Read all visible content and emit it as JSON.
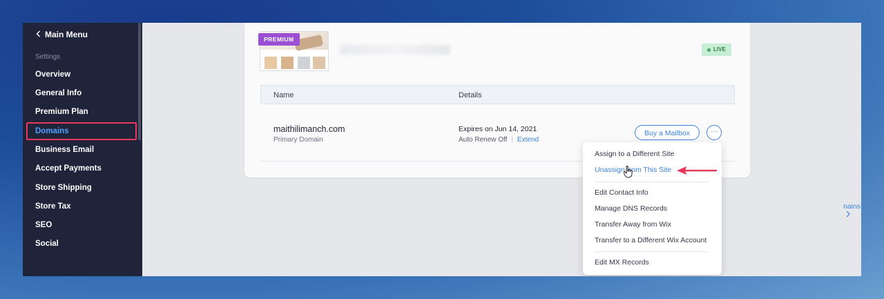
{
  "sidebar": {
    "back_label": "Main Menu",
    "section_label": "Settings",
    "items": [
      {
        "label": "Overview"
      },
      {
        "label": "General Info"
      },
      {
        "label": "Premium Plan"
      },
      {
        "label": "Domains"
      },
      {
        "label": "Business Email"
      },
      {
        "label": "Accept Payments"
      },
      {
        "label": "Store Shipping"
      },
      {
        "label": "Store Tax"
      },
      {
        "label": "SEO"
      },
      {
        "label": "Social"
      }
    ],
    "active": "Domains"
  },
  "site": {
    "premium_badge": "PREMIUM",
    "status_badge": "LIVE"
  },
  "table": {
    "col_name": "Name",
    "col_details": "Details"
  },
  "domain": {
    "name": "maithilimanch.com",
    "type": "Primary Domain",
    "expires": "Expires on Jun 14, 2021",
    "auto_renew": "Auto Renew Off",
    "separator": "|",
    "extend": "Extend",
    "mailbox_button": "Buy a Mailbox",
    "more_button": "···"
  },
  "peek_link": "nains",
  "menu": {
    "items": [
      "Assign to a Different Site",
      "Unassign from This Site",
      "Edit Contact Info",
      "Manage DNS Records",
      "Transfer Away from Wix",
      "Transfer to a Different Wix Account",
      "Edit MX Records"
    ]
  },
  "colors": {
    "accent": "#3b82e0",
    "sidebar_bg": "#20243a",
    "highlight_box": "#e8395c",
    "premium": "#9b4fd4",
    "live_bg": "#c6eed4"
  }
}
